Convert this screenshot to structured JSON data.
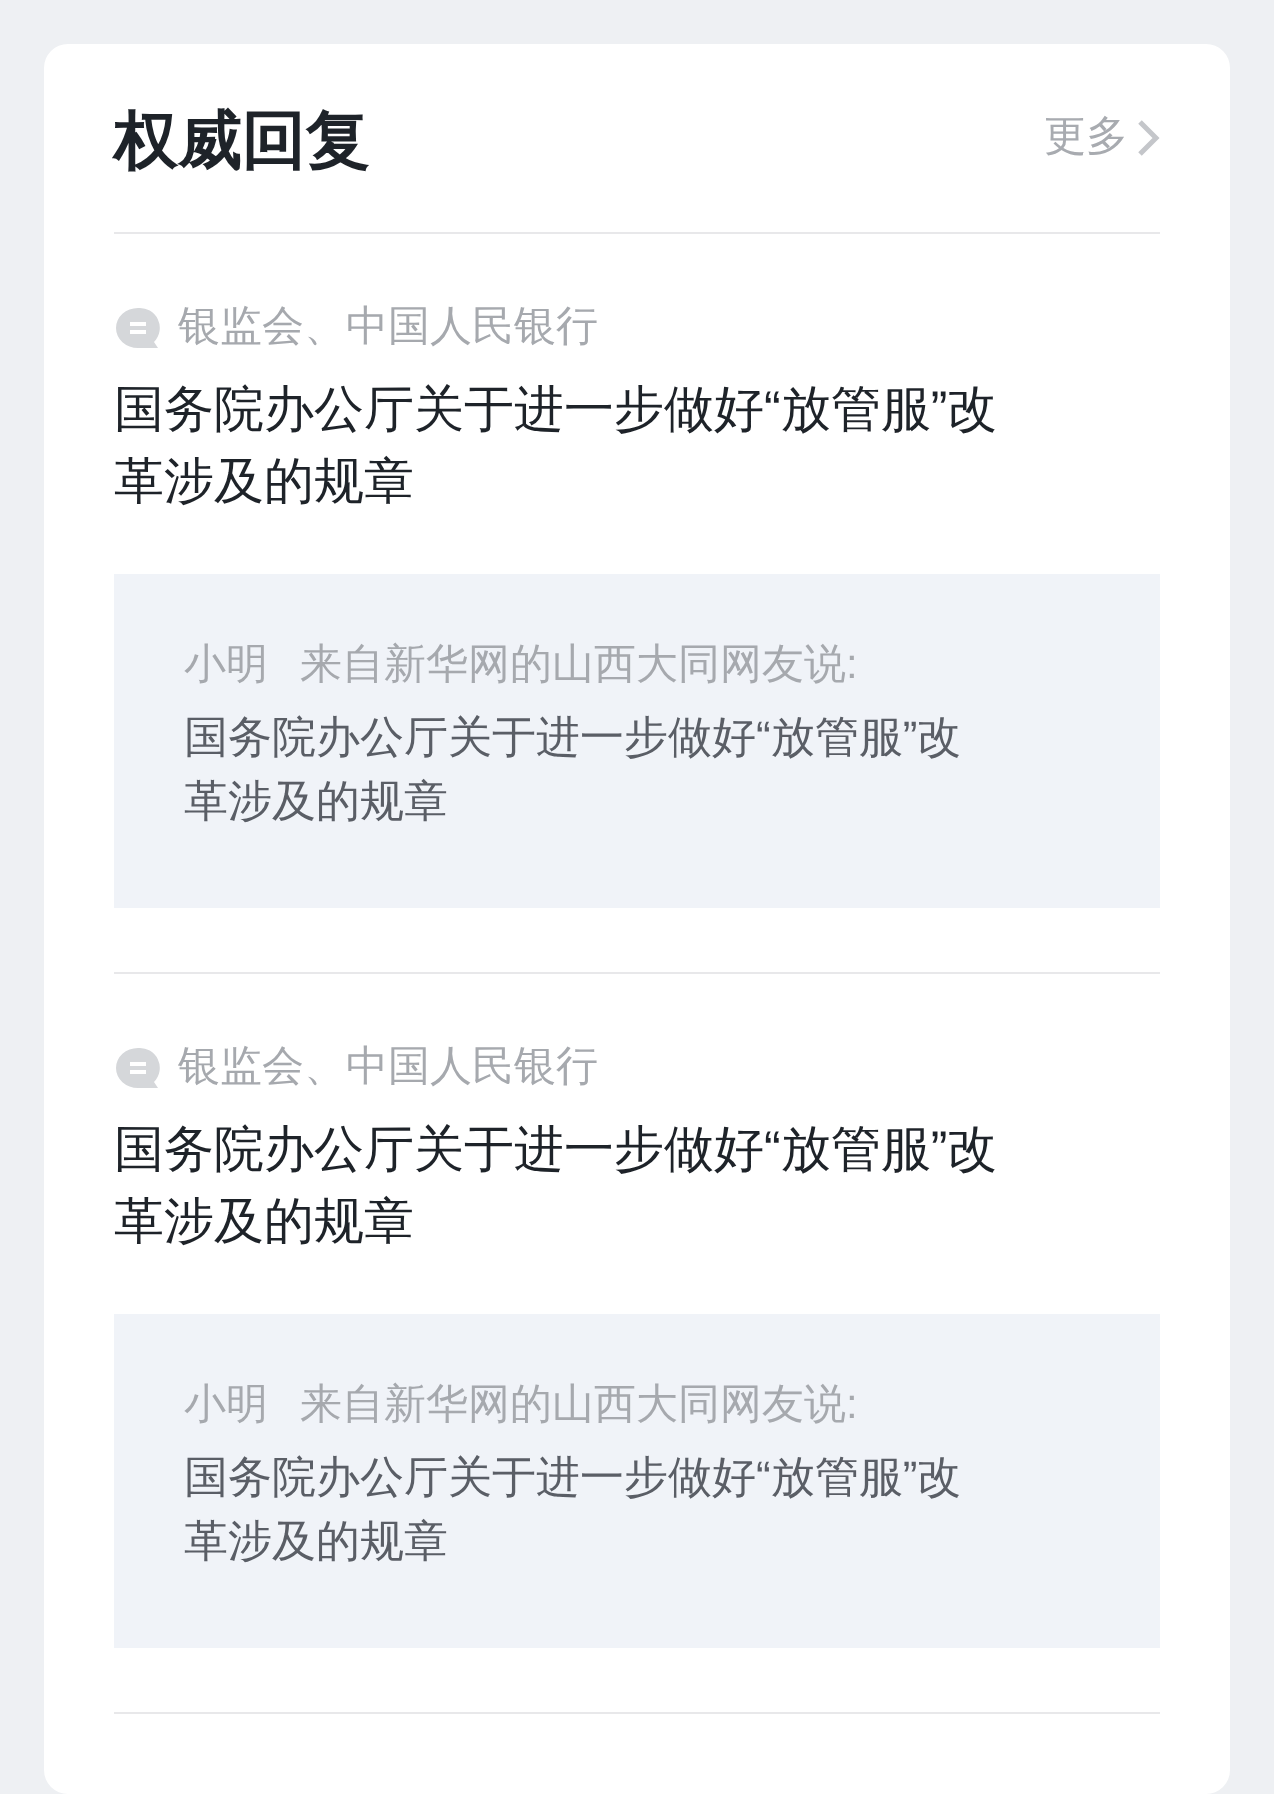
{
  "header": {
    "title": "权威回复",
    "more": "更多"
  },
  "items": [
    {
      "source": "银监会、中国人民银行",
      "title": "国务院办公厅关于进一步做好“放管服”改革涉及的规章",
      "quote": {
        "user": "小明",
        "origin": "来自新华网的山西大同网友说:",
        "text": "国务院办公厅关于进一步做好“放管服”改革涉及的规章"
      }
    },
    {
      "source": "银监会、中国人民银行",
      "title": "国务院办公厅关于进一步做好“放管服”改革涉及的规章",
      "quote": {
        "user": "小明",
        "origin": "来自新华网的山西大同网友说:",
        "text": "国务院办公厅关于进一步做好“放管服”改革涉及的规章"
      }
    }
  ]
}
